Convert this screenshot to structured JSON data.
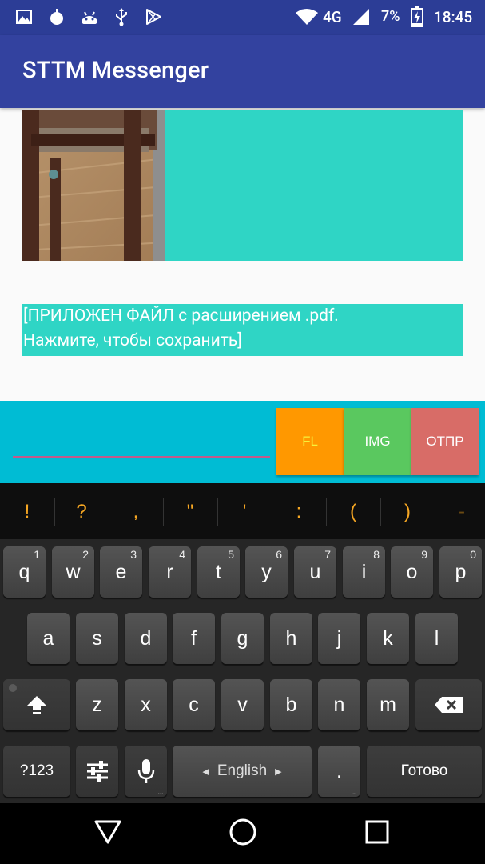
{
  "status_bar": {
    "icons_left": [
      "gallery-icon",
      "apple-icon",
      "android-icon",
      "usb-icon",
      "play-store-icon"
    ],
    "network": "4G",
    "battery_percent": "7%",
    "time": "18:45"
  },
  "app": {
    "title": "STTM Messenger"
  },
  "messages": [
    {
      "type": "image",
      "bubble_color": "#2fd5c5"
    },
    {
      "type": "file",
      "text_line1": "[ПРИЛОЖЕН ФАЙЛ с расширением .pdf.",
      "text_line2": "Нажмите, чтобы сохранить]"
    }
  ],
  "composer": {
    "input_value": "",
    "buttons": {
      "file": "FL",
      "image": "IMG",
      "send": "ОТПР"
    }
  },
  "keyboard": {
    "suggestions": [
      "!",
      "?",
      ",",
      "\"",
      "'",
      ":",
      "(",
      ")",
      "-"
    ],
    "row1": [
      {
        "k": "q",
        "h": "1"
      },
      {
        "k": "w",
        "h": "2"
      },
      {
        "k": "e",
        "h": "3"
      },
      {
        "k": "r",
        "h": "4"
      },
      {
        "k": "t",
        "h": "5"
      },
      {
        "k": "y",
        "h": "6"
      },
      {
        "k": "u",
        "h": "7"
      },
      {
        "k": "i",
        "h": "8"
      },
      {
        "k": "o",
        "h": "9"
      },
      {
        "k": "p",
        "h": "0"
      }
    ],
    "row2": [
      "a",
      "s",
      "d",
      "f",
      "g",
      "h",
      "j",
      "k",
      "l"
    ],
    "row3": [
      "z",
      "x",
      "c",
      "v",
      "b",
      "n",
      "m"
    ],
    "symbols_key": "?123",
    "space_label": "English",
    "period_key": ".",
    "done_key": "Готово"
  },
  "colors": {
    "app_bar": "#33429f",
    "input_bar": "#00bcd4",
    "fl_button": "#ff9800",
    "img_button": "#5ac85f",
    "send_button": "#d86c67"
  }
}
